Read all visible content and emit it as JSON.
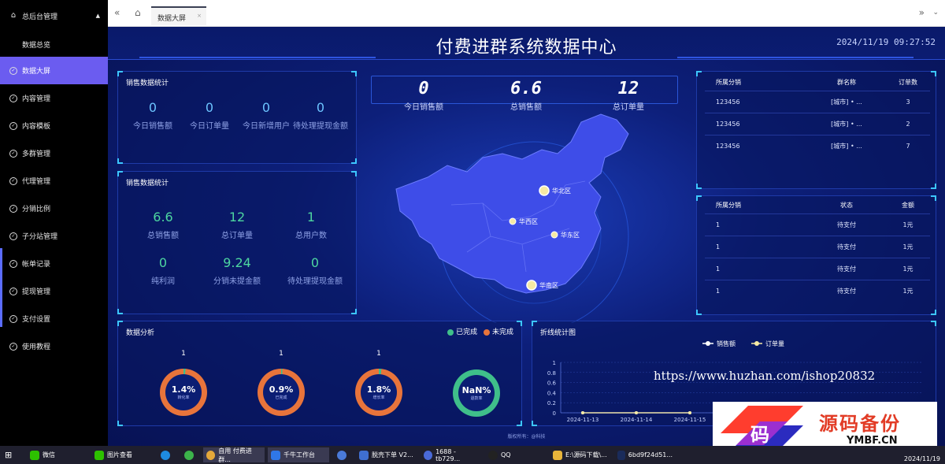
{
  "sidebar": {
    "header": "总后台管理",
    "sub_item": "数据总览",
    "items": [
      "数据大屏",
      "内容管理",
      "内容模板",
      "多群管理",
      "代理管理",
      "分销比例",
      "子分站管理",
      "帐单记录",
      "提现管理",
      "支付设置",
      "使用教程"
    ]
  },
  "topbar": {
    "tab_label": "数据大屏",
    "tab_close": "×"
  },
  "header": {
    "title": "付费进群系统数据中心",
    "datetime": "2024/11/19 09:27:52"
  },
  "sales_stats_1": {
    "title": "销售数据统计",
    "items": [
      {
        "value": "0",
        "label": "今日销售额"
      },
      {
        "value": "0",
        "label": "今日订单量"
      },
      {
        "value": "0",
        "label": "今日新增用户"
      },
      {
        "value": "0",
        "label": "待处理提现金额"
      }
    ]
  },
  "sales_stats_2": {
    "title": "销售数据统计",
    "items": [
      {
        "value": "6.6",
        "label": "总销售额"
      },
      {
        "value": "12",
        "label": "总订单量"
      },
      {
        "value": "1",
        "label": "总用户数"
      },
      {
        "value": "0",
        "label": "纯利润"
      },
      {
        "value": "9.24",
        "label": "分销未提金额"
      },
      {
        "value": "0",
        "label": "待处理提现金额"
      }
    ]
  },
  "kpis": [
    {
      "value": "0",
      "label": "今日销售额"
    },
    {
      "value": "6.6",
      "label": "总销售额"
    },
    {
      "value": "12",
      "label": "总订单量"
    }
  ],
  "map": {
    "regions": [
      "华北区",
      "华西区",
      "华东区",
      "华南区"
    ]
  },
  "table_groups": {
    "headers": [
      "所属分销",
      "群名称",
      "订单数"
    ],
    "rows": [
      [
        "123456",
        "[城市] • ...",
        "3"
      ],
      [
        "123456",
        "[城市] • ...",
        "2"
      ],
      [
        "123456",
        "[城市] • ...",
        "7"
      ]
    ]
  },
  "table_orders": {
    "headers": [
      "所属分销",
      "状态",
      "金额"
    ],
    "rows": [
      [
        "1",
        "待支付",
        "1元"
      ],
      [
        "1",
        "待支付",
        "1元"
      ],
      [
        "1",
        "待支付",
        "1元"
      ],
      [
        "1",
        "待支付",
        "1元"
      ]
    ]
  },
  "analysis": {
    "title": "数据分析",
    "legend_done": "已完成",
    "legend_undone": "未完成",
    "color_done": "#3fbf8a",
    "color_undone": "#e8743b",
    "donuts": [
      {
        "count": "1",
        "pct": "1.4%",
        "sub": "转化率"
      },
      {
        "count": "1",
        "pct": "0.9%",
        "sub": "已完成"
      },
      {
        "count": "1",
        "pct": "1.8%",
        "sub": "增长率"
      },
      {
        "count": "",
        "pct": "NaN%",
        "sub": "退款率"
      }
    ]
  },
  "chart_data": {
    "type": "line",
    "title": "折线统计图",
    "x": [
      "2024-11-13",
      "2024-11-14",
      "2024-11-15"
    ],
    "series": [
      {
        "name": "销售额",
        "values": [
          0,
          0,
          0
        ]
      },
      {
        "name": "订单量",
        "values": [
          0,
          0,
          0
        ]
      }
    ],
    "yticks": [
      "1",
      "0.8",
      "0.6",
      "0.4",
      "0.2",
      "0"
    ],
    "ylim": [
      0,
      1
    ],
    "grid": true,
    "legend": "top-center"
  },
  "footer": {
    "copyright": "版权所有：@科技"
  },
  "watermark": {
    "url": "https://www.huzhan.com/ishop20832",
    "logo_text": "源码备份",
    "logo_sub": "YMBF.CN",
    "logo_char": "码"
  },
  "taskbar": {
    "items": [
      "微信",
      "图片查看",
      "",
      "",
      "自用 付费进群...",
      "千牛工作台",
      "",
      "脱壳下单 V2...",
      "1688 - tb729...",
      "QQ",
      "E:\\源码下载\\...",
      "6bd9f24d51..."
    ],
    "date": "2024/11/19"
  }
}
